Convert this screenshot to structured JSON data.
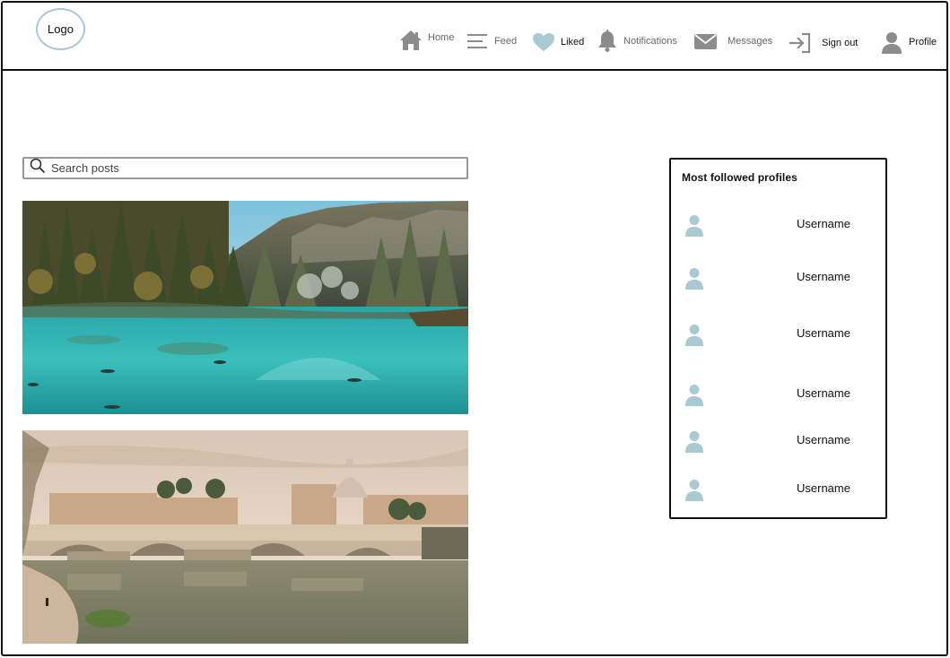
{
  "header": {
    "logo_label": "Logo",
    "nav": [
      {
        "label": "Home",
        "icon": "home-icon",
        "active": false
      },
      {
        "label": "Feed",
        "icon": "feed-icon",
        "active": false
      },
      {
        "label": "Liked",
        "icon": "heart-icon",
        "active": true
      },
      {
        "label": "Notifications",
        "icon": "bell-icon",
        "active": false
      },
      {
        "label": "Messages",
        "icon": "envelope-icon",
        "active": false
      },
      {
        "label": "Sign out",
        "icon": "sign-out-icon",
        "active": true
      },
      {
        "label": "Profile",
        "icon": "user-icon",
        "active": true
      }
    ]
  },
  "search": {
    "placeholder": "Search posts"
  },
  "posts": [
    {
      "image": "lake-forest-photo"
    },
    {
      "image": "river-bridge-city-photo"
    }
  ],
  "sidebar": {
    "title": "Most followed profiles",
    "profiles": [
      {
        "username": "Username"
      },
      {
        "username": "Username"
      },
      {
        "username": "Username"
      },
      {
        "username": "Username"
      },
      {
        "username": "Username"
      },
      {
        "username": "Username"
      }
    ]
  },
  "colors": {
    "accent": "#a9c9d3",
    "icon_gray": "#8c8c8c",
    "border": "#111111"
  }
}
